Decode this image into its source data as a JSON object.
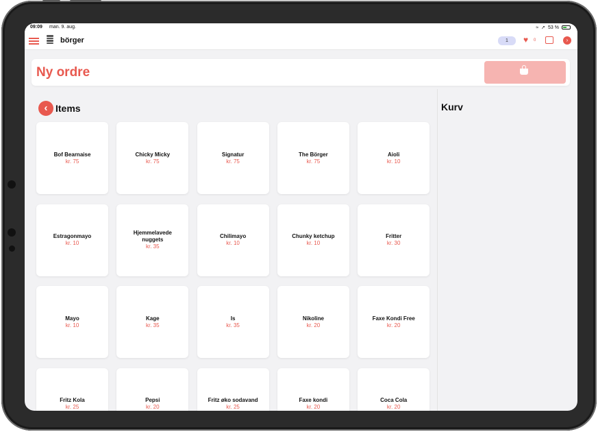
{
  "status": {
    "time": "09:09",
    "date": "man. 9. aug.",
    "battery": "53 %"
  },
  "header": {
    "app_name": "börger",
    "order_count": "1",
    "favorites_count": "0"
  },
  "order": {
    "title": "Ny ordre"
  },
  "items_section": {
    "title": "Items"
  },
  "cart": {
    "title": "Kurv"
  },
  "items": [
    {
      "name": "Bof Bearnaise",
      "price": "kr. 75"
    },
    {
      "name": "Chicky Micky",
      "price": "kr. 75"
    },
    {
      "name": "Signatur",
      "price": "kr. 75"
    },
    {
      "name": "The Börger",
      "price": "kr. 75"
    },
    {
      "name": "Aioli",
      "price": "kr. 10"
    },
    {
      "name": "Estragonmayo",
      "price": "kr. 10"
    },
    {
      "name": "Hjemmelavede nuggets",
      "price": "kr. 35"
    },
    {
      "name": "Chilimayo",
      "price": "kr. 10"
    },
    {
      "name": "Chunky ketchup",
      "price": "kr. 10"
    },
    {
      "name": "Fritter",
      "price": "kr. 30"
    },
    {
      "name": "Mayo",
      "price": "kr. 10"
    },
    {
      "name": "Kage",
      "price": "kr. 35"
    },
    {
      "name": "Is",
      "price": "kr. 35"
    },
    {
      "name": "Nikoline",
      "price": "kr. 20"
    },
    {
      "name": "Faxe Kondi Free",
      "price": "kr. 20"
    },
    {
      "name": "Fritz Kola",
      "price": "kr. 25"
    },
    {
      "name": "Pepsi",
      "price": "kr. 20"
    },
    {
      "name": "Fritz øko sodavand",
      "price": "kr. 25"
    },
    {
      "name": "Faxe kondi",
      "price": "kr. 20"
    },
    {
      "name": "Coca Cola",
      "price": "kr. 20"
    }
  ],
  "colors": {
    "accent": "#e8594f",
    "accent_light": "#f6b4b1",
    "background": "#f2f2f4"
  }
}
